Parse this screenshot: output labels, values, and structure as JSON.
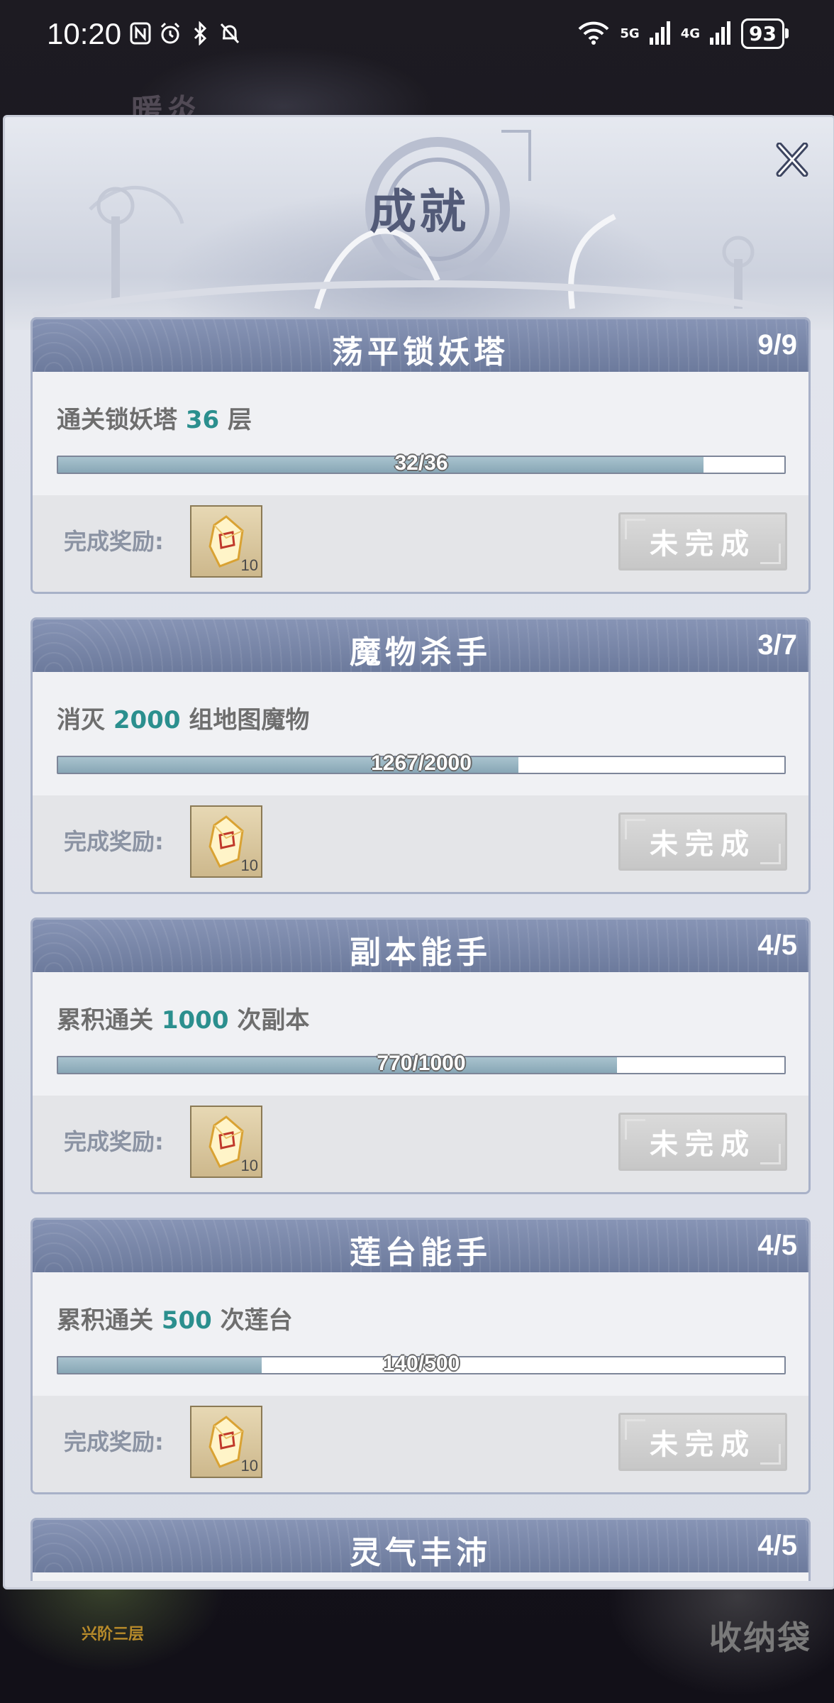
{
  "status_bar": {
    "time": "10:20",
    "battery": "93",
    "network_1": "5G",
    "network_2": "4G"
  },
  "background": {
    "top_text": "暖炎",
    "left_label": "兴阶三层",
    "right_label": "收纳袋"
  },
  "panel": {
    "title": "成就"
  },
  "achievements": [
    {
      "title": "荡平锁妖塔",
      "count": "9/9",
      "desc_pre": "通关锁妖塔 ",
      "desc_num": "36",
      "desc_post": " 层",
      "progress_text": "32/36",
      "progress": 0.889,
      "reward_label": "完成奖励:",
      "reward_qty": "10",
      "status": "未完成"
    },
    {
      "title": "魔物杀手",
      "count": "3/7",
      "desc_pre": "消灭 ",
      "desc_num": "2000",
      "desc_post": " 组地图魔物",
      "progress_text": "1267/2000",
      "progress": 0.634,
      "reward_label": "完成奖励:",
      "reward_qty": "10",
      "status": "未完成"
    },
    {
      "title": "副本能手",
      "count": "4/5",
      "desc_pre": "累积通关 ",
      "desc_num": "1000",
      "desc_post": " 次副本",
      "progress_text": "770/1000",
      "progress": 0.77,
      "reward_label": "完成奖励:",
      "reward_qty": "10",
      "status": "未完成"
    },
    {
      "title": "莲台能手",
      "count": "4/5",
      "desc_pre": "累积通关 ",
      "desc_num": "500",
      "desc_post": " 次莲台",
      "progress_text": "140/500",
      "progress": 0.28,
      "reward_label": "完成奖励:",
      "reward_qty": "10",
      "status": "未完成"
    },
    {
      "title": "灵气丰沛",
      "count": "4/5"
    }
  ]
}
